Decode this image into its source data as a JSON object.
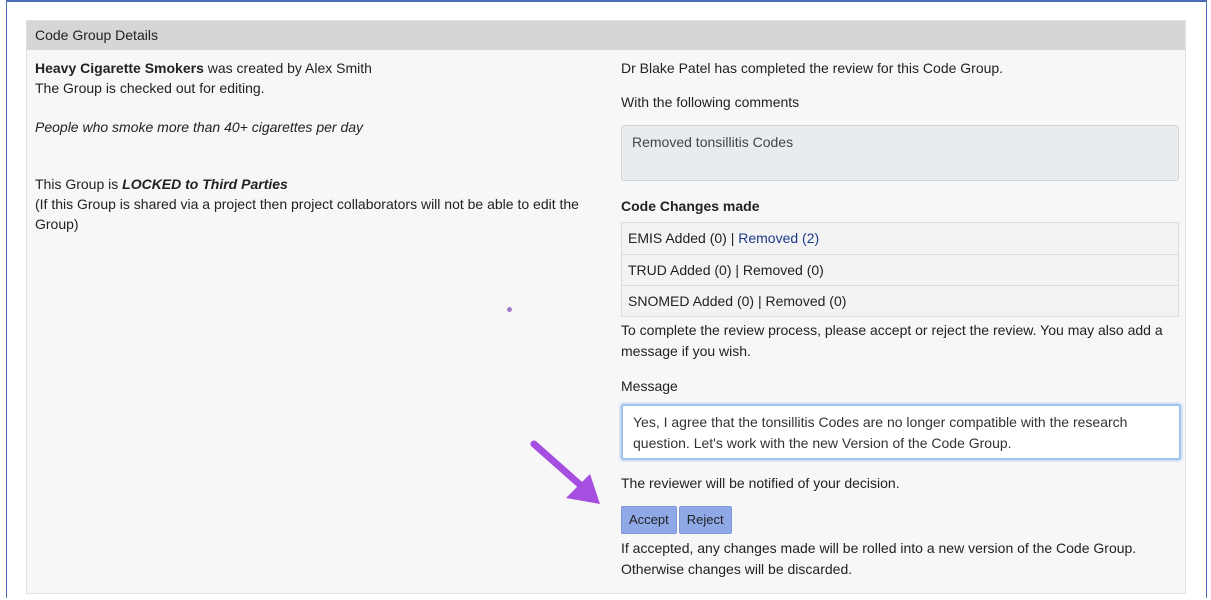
{
  "panel": {
    "header": "Code Group Details"
  },
  "left": {
    "group_name": "Heavy Cigarette Smokers",
    "created_by_text": " was created by Alex Smith",
    "checked_out_text": "The Group is checked out for editing.",
    "description": "People who smoke more than 40+ cigarettes per day",
    "locked_prefix": "This Group is ",
    "locked_status": "LOCKED to Third Parties",
    "locked_note": "(If this Group is shared via a project then project collaborators will not be able to edit the Group)"
  },
  "right": {
    "review_completed": "Dr Blake Patel has completed the review for this Code Group.",
    "comments_label": "With the following comments",
    "comment_text": "Removed tonsillitis Codes",
    "changes_heading": "Code Changes made",
    "changes": [
      {
        "prefix": "EMIS Added (0) | ",
        "removed": "Removed (2)"
      },
      {
        "prefix": "TRUD Added (0) | ",
        "removed": "Removed (0)"
      },
      {
        "prefix": "SNOMED Added (0) | ",
        "removed": "Removed (0)"
      }
    ],
    "instructions": "To complete the review process, please accept or reject the review. You may also add a message if you wish.",
    "message_label": "Message",
    "message_text": "Yes, I agree that the tonsillitis Codes are no longer compatible with the research question. Let's work with the new Version of the Code Group.",
    "notify_text": "The reviewer will be notified of your decision.",
    "accept_label": "Accept",
    "reject_label": "Reject",
    "footer_note": "If accepted, any changes made will be rolled into a new version of the Code Group. Otherwise changes will be discarded."
  },
  "colors": {
    "frame": "#4a6fb5",
    "header_bg": "#d6d6d6",
    "button_bg": "#8fa8e6",
    "arrow": "#a64ee0",
    "link": "#1a3c8a"
  }
}
